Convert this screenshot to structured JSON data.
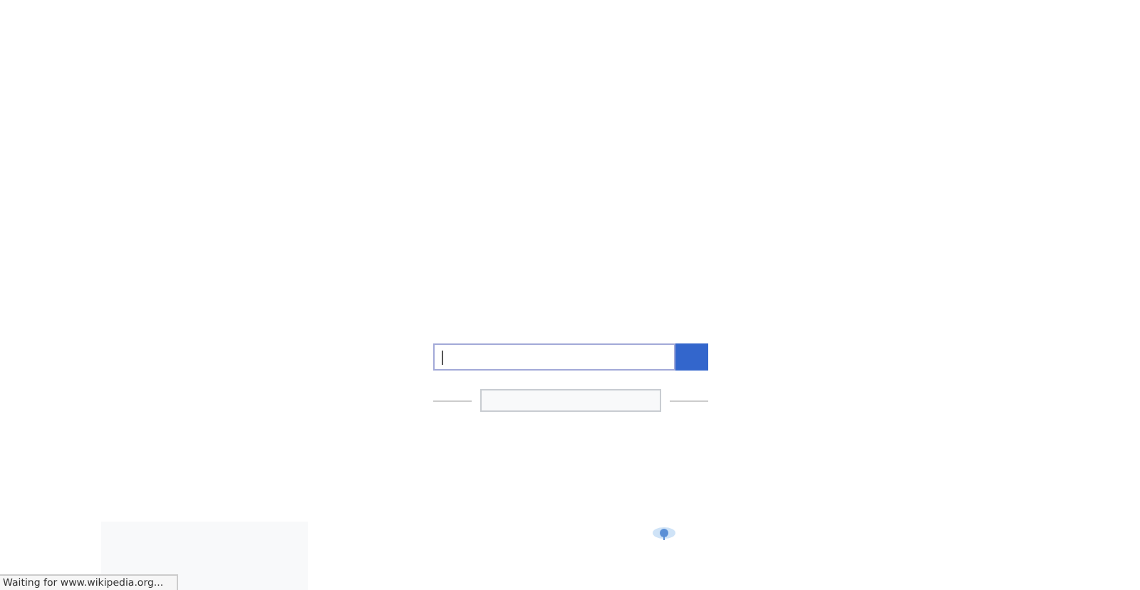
{
  "status_bar": {
    "text": "Waiting for www.wikipedia.org..."
  }
}
